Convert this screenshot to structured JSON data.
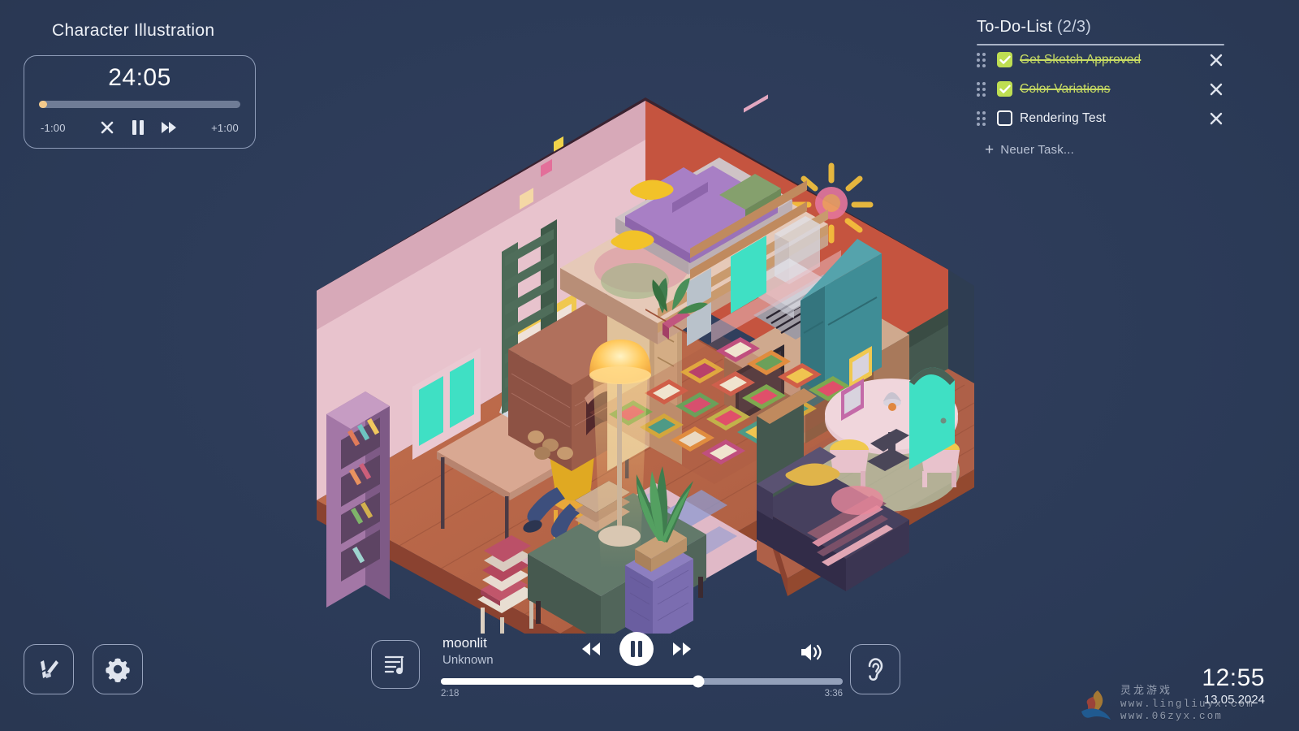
{
  "theme": {
    "background": "#2b3a57",
    "accent_check": "#bede52",
    "text_primary": "#eef1f7",
    "text_muted": "#b9c2d4",
    "timer_fill": "#f3c98b"
  },
  "project": {
    "title": "Character Illustration"
  },
  "timer": {
    "time": "24:05",
    "progress_percent": 4,
    "decrease_label": "-1:00",
    "increase_label": "+1:00",
    "buttons": [
      {
        "name": "reset",
        "icon": "close-icon"
      },
      {
        "name": "pause",
        "icon": "pause-icon"
      },
      {
        "name": "skip",
        "icon": "fast-forward-icon"
      }
    ]
  },
  "todo": {
    "title": "To-Do-List",
    "count": "(2/3)",
    "items": [
      {
        "label": "Get Sketch Approved",
        "done": true
      },
      {
        "label": "Color Variations",
        "done": true
      },
      {
        "label": "Rendering Test",
        "done": false
      }
    ],
    "add_label": "Neuer Task...",
    "add_plus": "+"
  },
  "toolbar": {
    "brush_label": "Brush",
    "settings_label": "Settings",
    "ambient_label": "Ambient Sounds"
  },
  "player": {
    "track_title": "moonlit",
    "track_artist": "Unknown",
    "elapsed": "2:18",
    "duration": "3:36",
    "progress_percent": 64,
    "playlist_icon": "playlist-icon",
    "prev_icon": "rewind-icon",
    "play_icon": "pause-icon",
    "next_icon": "fast-forward-icon",
    "volume_icon": "volume-icon"
  },
  "clock": {
    "time": "12:55",
    "date": "13.05.2024"
  },
  "watermark": {
    "line1": "www.lingliuyx.com",
    "line2": "www.06zyx.com",
    "cn": "灵龙游戏"
  },
  "illustration": {
    "name": "isometric-cutaway-house",
    "description": "Isometric cutaway of a cozy two-room house at night with a character working at a laptop",
    "rooms": [
      "study",
      "loft-bedroom",
      "kitchen",
      "dining-room",
      "living-room"
    ]
  }
}
